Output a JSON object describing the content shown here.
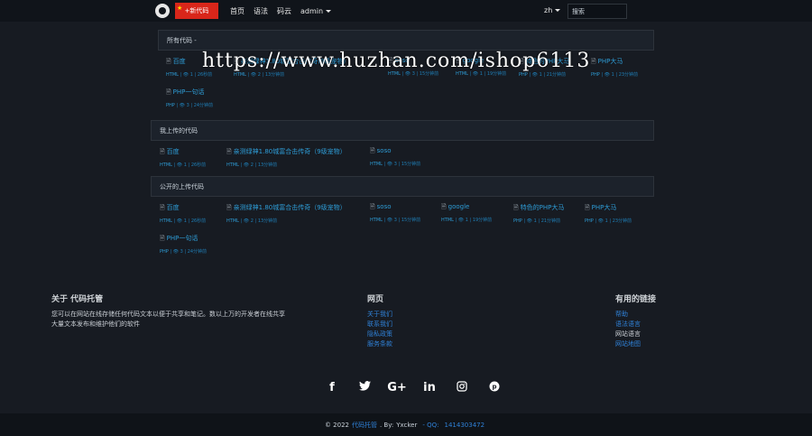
{
  "navbar": {
    "new_code_label": "+新代码",
    "links": [
      "首页",
      "语法",
      "码云"
    ],
    "user": "admin",
    "language": "zh",
    "search_placeholder": "搜索"
  },
  "watermark": "https://www.huzhan.com/ishop6113",
  "sections": [
    {
      "heading": "所有代码 -",
      "items": [
        {
          "title": "百度",
          "lang": "HTML",
          "views": "1",
          "time": "26秒前"
        },
        {
          "title": "亲测绿神1.80城富合击传奇(9级宠物)",
          "lang": "HTML",
          "views": "2",
          "time": "13分钟前"
        },
        {
          "title": "soso",
          "lang": "HTML",
          "views": "3",
          "time": "15分钟前"
        },
        {
          "title": "google",
          "lang": "HTML",
          "views": "1",
          "time": "19分钟前"
        },
        {
          "title": "特色的PHP大马",
          "lang": "PHP",
          "views": "1",
          "time": "21分钟前"
        },
        {
          "title": "PHP大马",
          "lang": "PHP",
          "views": "1",
          "time": "23分钟前"
        },
        {
          "title": "PHP一句话",
          "lang": "PHP",
          "views": "3",
          "time": "24分钟前"
        }
      ]
    },
    {
      "heading": "我上传的代码",
      "items": [
        {
          "title": "百度",
          "lang": "HTML",
          "views": "1",
          "time": "26秒前"
        },
        {
          "title": "亲测绿神1.80城富合击传奇（9级宠物）",
          "lang": "HTML",
          "views": "2",
          "time": "13分钟前"
        },
        {
          "title": "soso",
          "lang": "HTML",
          "views": "3",
          "time": "15分钟前"
        }
      ]
    },
    {
      "heading": "公开的上传代码",
      "items": [
        {
          "title": "百度",
          "lang": "HTML",
          "views": "1",
          "time": "26秒前"
        },
        {
          "title": "亲测绿神1.80城富合击传奇（9级宠物）",
          "lang": "HTML",
          "views": "2",
          "time": "13分钟前"
        },
        {
          "title": "soso",
          "lang": "HTML",
          "views": "3",
          "time": "15分钟前"
        },
        {
          "title": "google",
          "lang": "HTML",
          "views": "1",
          "time": "19分钟前"
        },
        {
          "title": "特色的PHP大马",
          "lang": "PHP",
          "views": "1",
          "time": "21分钟前"
        },
        {
          "title": "PHP大马",
          "lang": "PHP",
          "views": "1",
          "time": "23分钟前"
        },
        {
          "title": "PHP一句话",
          "lang": "PHP",
          "views": "3",
          "time": "24分钟前"
        }
      ]
    }
  ],
  "footer": {
    "about_heading": "关于 代码托管",
    "about_text_1": "您可以在网站在线存储任何代码文本以便于共享和笔记。数以上万的开发者在线共享",
    "about_text_2": "大量文本发布和维护他们的软件",
    "pages_heading": "网页",
    "pages_links": [
      "关于我们",
      "联系我们",
      "隐私政策",
      "服务条款"
    ],
    "useful_heading": "有用的链接",
    "useful_links": [
      "帮助",
      "语法语言",
      "网站语言",
      "网站地图"
    ],
    "social_icons": [
      "facebook-icon",
      "twitter-icon",
      "google-plus-icon",
      "linkedin-icon",
      "instagram-icon",
      "pinterest-icon"
    ],
    "social_glyphs": [
      "f",
      "🐦",
      "G+",
      "in",
      "◎",
      "℗"
    ],
    "copyright_prefix": "© 2022",
    "site_name": "代码托管",
    "by_label": ". By:",
    "author": "Yxcker",
    "qq_label": "- QQ:",
    "qq": "1414303472"
  }
}
